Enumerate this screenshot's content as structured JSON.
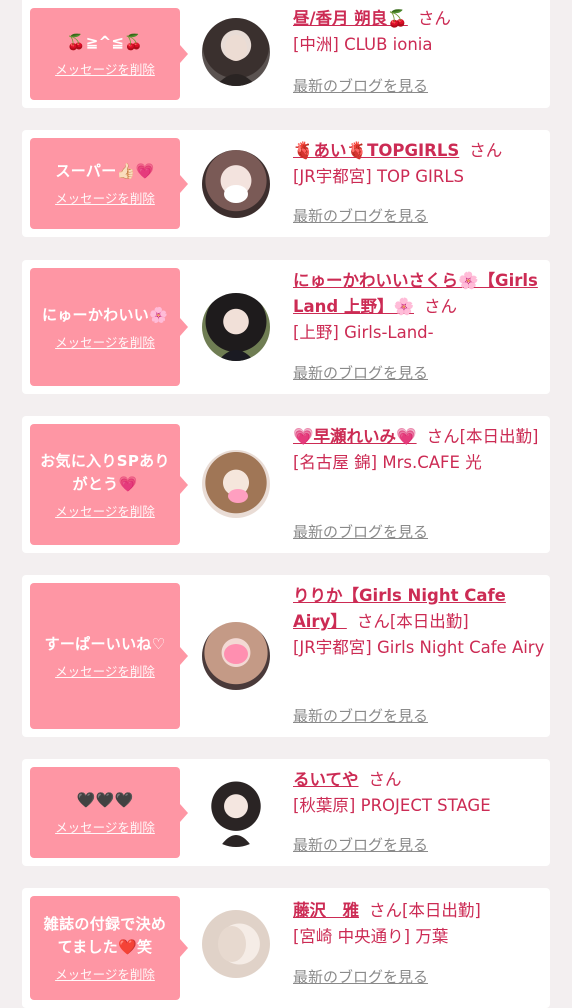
{
  "colors": {
    "accent": "#cc2b54",
    "bubble": "#fe96a4",
    "link_gray": "#8a8a8a",
    "background": "#f3eff0"
  },
  "labels": {
    "delete_message": "メッセージを削除",
    "blog_link": "最新のブログを見る",
    "honorific": "さん"
  },
  "items": [
    {
      "message": "🍒≧^≦🍒",
      "name": "昼/香月 朔良🍒",
      "suffix": "",
      "shop": "[中洲] CLUB ionia"
    },
    {
      "message": "スーパー👍🏻💗",
      "name": "🫀あい🫀TOPGIRLS",
      "suffix": "",
      "shop": "[JR宇都宮] TOP GIRLS"
    },
    {
      "message": "にゅーかわいい🌸",
      "name": "にゅーかわいいさくら🌸【Girls Land 上野】🌸",
      "suffix": "",
      "shop": "[上野] Girls-Land-"
    },
    {
      "message": "お気に入りSPありがとう💗",
      "name": "💗早瀬れいみ💗",
      "suffix": "[本日出勤]",
      "shop": "[名古屋 錦] Mrs.CAFE 光"
    },
    {
      "message": "すーぱーいいね♡",
      "name": "りりか【Girls Night Cafe Airy】",
      "suffix": "[本日出勤]",
      "shop": "[JR宇都宮] Girls Night Cafe Airy"
    },
    {
      "message": "🖤🖤🖤",
      "name": "るいてや",
      "suffix": "",
      "shop": "[秋葉原] PROJECT STAGE"
    },
    {
      "message": "雑誌の付録で決めてました❤️笑",
      "name": "藤沢　雅",
      "suffix": "[本日出勤]",
      "shop": "[宮崎 中央通り] 万葉"
    }
  ]
}
